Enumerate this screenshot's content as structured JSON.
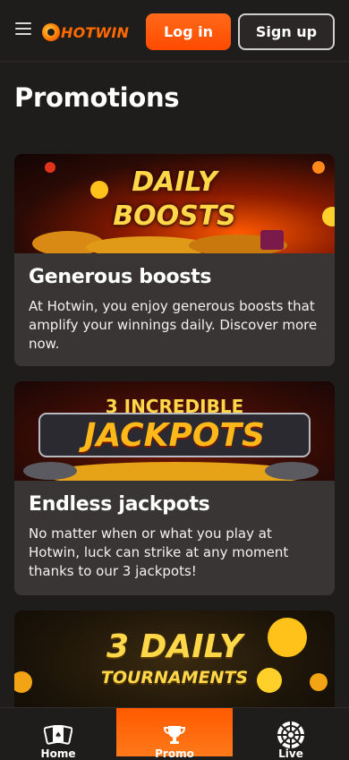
{
  "header": {
    "logo_text": "HOTWIN",
    "login_label": "Log in",
    "signup_label": "Sign up"
  },
  "page": {
    "title": "Promotions"
  },
  "promotions": [
    {
      "banner_line1": "DAILY",
      "banner_line2": "BOOSTS",
      "title": "Generous boosts",
      "description": "At Hotwin, you enjoy generous boosts that amplify your winnings daily. Discover more now."
    },
    {
      "banner_line1": "3 INCREDIBLE",
      "banner_line2": "JACKPOTS",
      "title": "Endless jackpots",
      "description": "No matter when or what you play at Hotwin, luck can strike at any moment thanks to our 3 jackpots!"
    },
    {
      "banner_line1": "3 DAILY",
      "banner_line2": "TOURNAMENTS"
    }
  ],
  "bottom_nav": [
    {
      "label": "Home",
      "icon": "cards-icon"
    },
    {
      "label": "Promo",
      "icon": "trophy-icon"
    },
    {
      "label": "Live",
      "icon": "roulette-icon"
    }
  ],
  "colors": {
    "accent": "#ff5a00",
    "background": "#1f1d1c",
    "card": "#383534"
  }
}
